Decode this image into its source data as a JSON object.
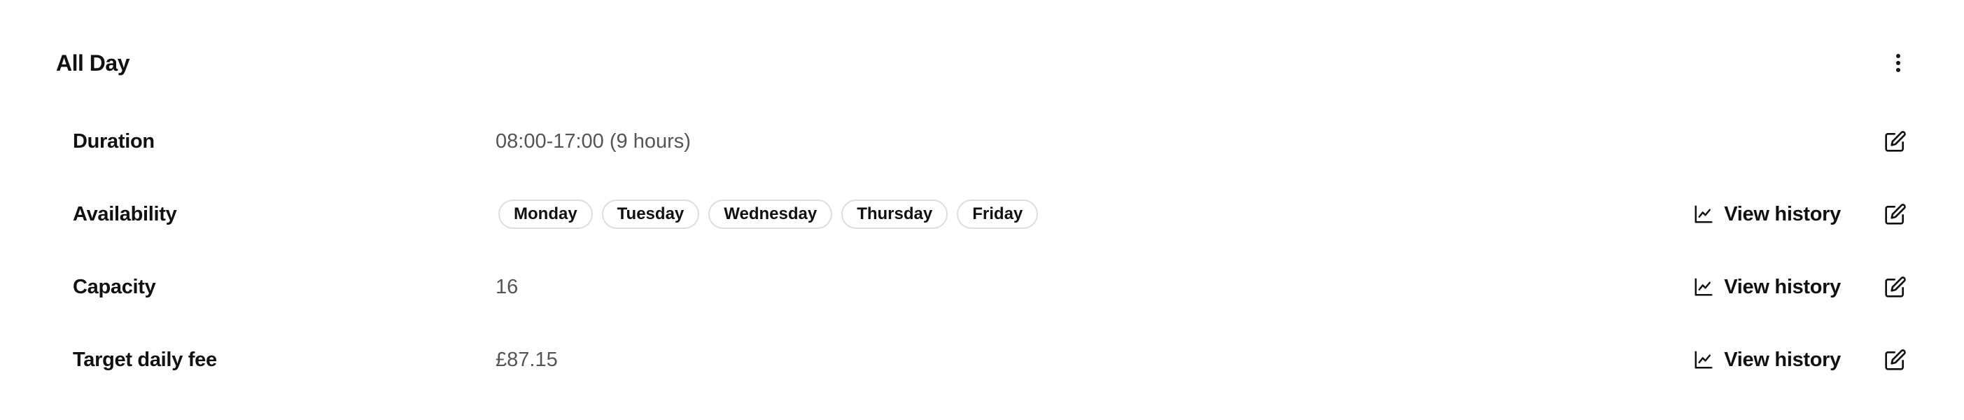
{
  "header": {
    "title": "All Day",
    "menu_icon": "more-vertical-icon"
  },
  "rows": [
    {
      "label": "Duration",
      "value": "08:00-17:00 (9 hours)",
      "has_history": false,
      "edit_icon": "edit-icon"
    },
    {
      "label": "Availability",
      "days": [
        "Monday",
        "Tuesday",
        "Wednesday",
        "Thursday",
        "Friday"
      ],
      "has_history": true,
      "edit_icon": "edit-icon"
    },
    {
      "label": "Capacity",
      "value": "16",
      "has_history": true,
      "edit_icon": "edit-icon"
    },
    {
      "label": "Target daily fee",
      "value": "£87.15",
      "has_history": true,
      "edit_icon": "edit-icon"
    }
  ],
  "history_button": {
    "label": "View history",
    "icon": "line-chart-icon"
  },
  "colors": {
    "text_primary": "#111111",
    "text_secondary": "#555555",
    "pill_border": "#dedede",
    "background": "#ffffff"
  }
}
